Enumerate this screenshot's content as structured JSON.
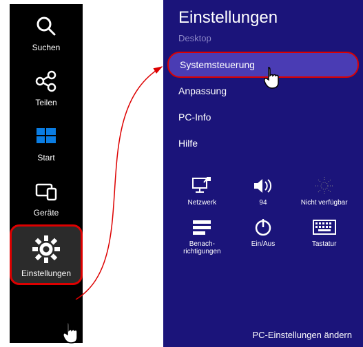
{
  "charms": {
    "search": "Suchen",
    "share": "Teilen",
    "start": "Start",
    "devices": "Geräte",
    "settings": "Einstellungen"
  },
  "panel": {
    "title": "Einstellungen",
    "context": "Desktop",
    "items": {
      "control_panel": "Systemsteuerung",
      "personalization": "Anpassung",
      "pc_info": "PC-Info",
      "help": "Hilfe"
    },
    "tiles": {
      "network": "Netzwerk",
      "volume": "94",
      "brightness": "Nicht verfügbar",
      "notifications": "Benach-richtigungen",
      "power": "Ein/Aus",
      "keyboard": "Tastatur"
    },
    "change_pc_settings": "PC-Einstellungen ändern"
  }
}
